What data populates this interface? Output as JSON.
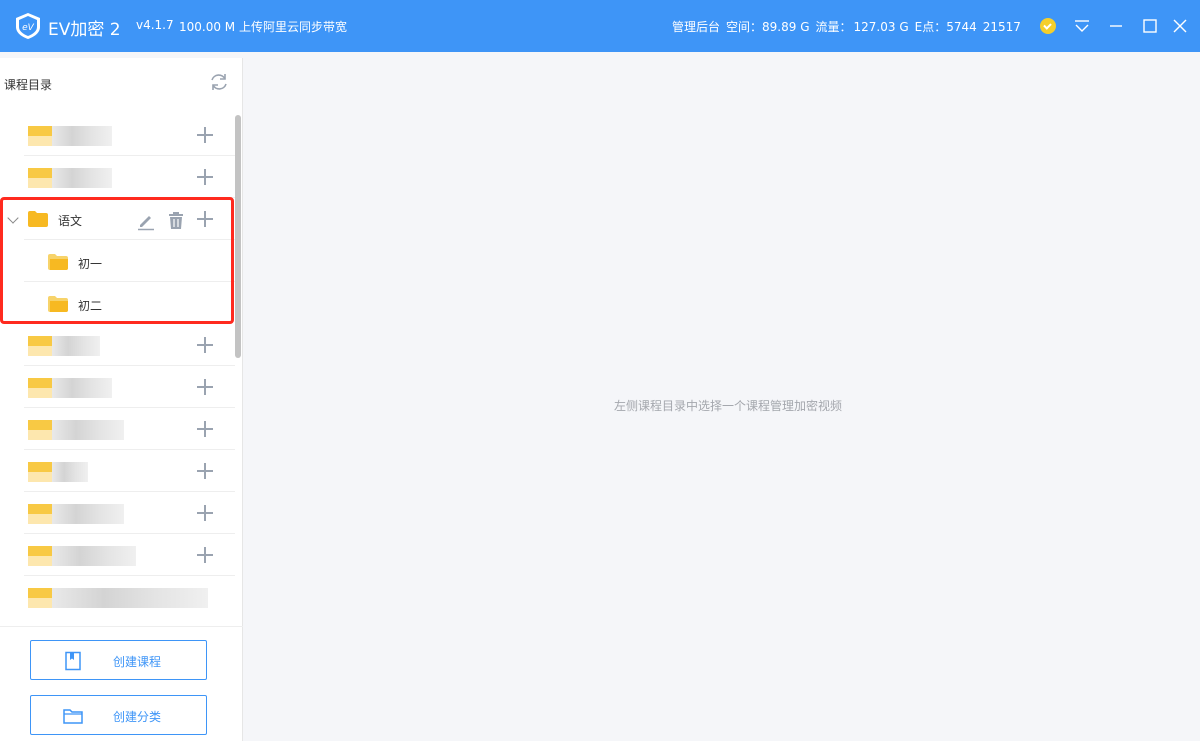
{
  "titlebar": {
    "app_name": "EV加密 2",
    "version": "v4.1.7",
    "upload_speed": "100.00 M 上传阿里云同步带宽",
    "admin_link": "管理后台",
    "space_label": "空间：",
    "space_value": "89.89 G",
    "traffic_label": "流量：",
    "traffic_value": "127.03 G",
    "epoints_label": "E点：",
    "epoints_value": "5744",
    "user_id": "21517",
    "accent_color": "#3e95f7"
  },
  "sidebar": {
    "title": "课程目录",
    "refresh_icon": "refresh-icon",
    "expanded_category": {
      "label": "语文",
      "children": [
        {
          "label": "初一"
        },
        {
          "label": "初二"
        }
      ]
    },
    "highlight_color": "#ff2a1f",
    "buttons": {
      "create_course": "创建课程",
      "create_category": "创建分类"
    }
  },
  "main": {
    "empty_hint": "左侧课程目录中选择一个课程管理加密视频"
  }
}
